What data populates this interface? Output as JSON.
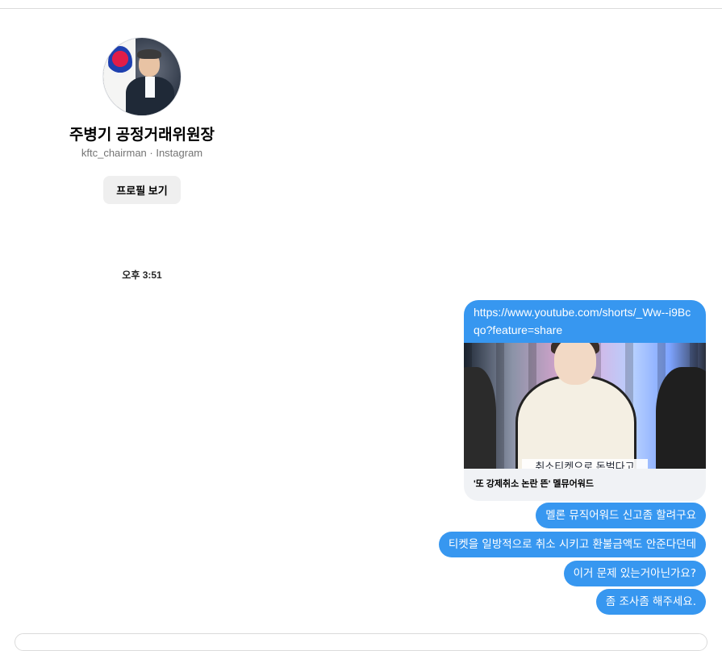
{
  "profile": {
    "name": "주병기 공정거래위원장",
    "subtitle": "kftc_chairman · Instagram",
    "button_label": "프로필 보기",
    "avatar_icon": "profile-photo"
  },
  "timestamp": "오후 3:51",
  "link_card": {
    "url": "https://www.youtube.com/shorts/_Ww--i9Bcqo?feature=share",
    "thumbnail_caption": "취소티켓으로 돈벌다고",
    "title": "'또 강제취소 논란 뜬' 멜뮤어워드"
  },
  "messages": [
    "멜론 뮤직어워드 신고좀 할려구요",
    "티켓을 일방적으로 취소 시키고 환불금액도 안준다던데",
    "이거 문제 있는거아닌가요?",
    "좀 조사좀 해주세요."
  ],
  "colors": {
    "bubble": "#3797f0",
    "button_bg": "#efefef"
  }
}
